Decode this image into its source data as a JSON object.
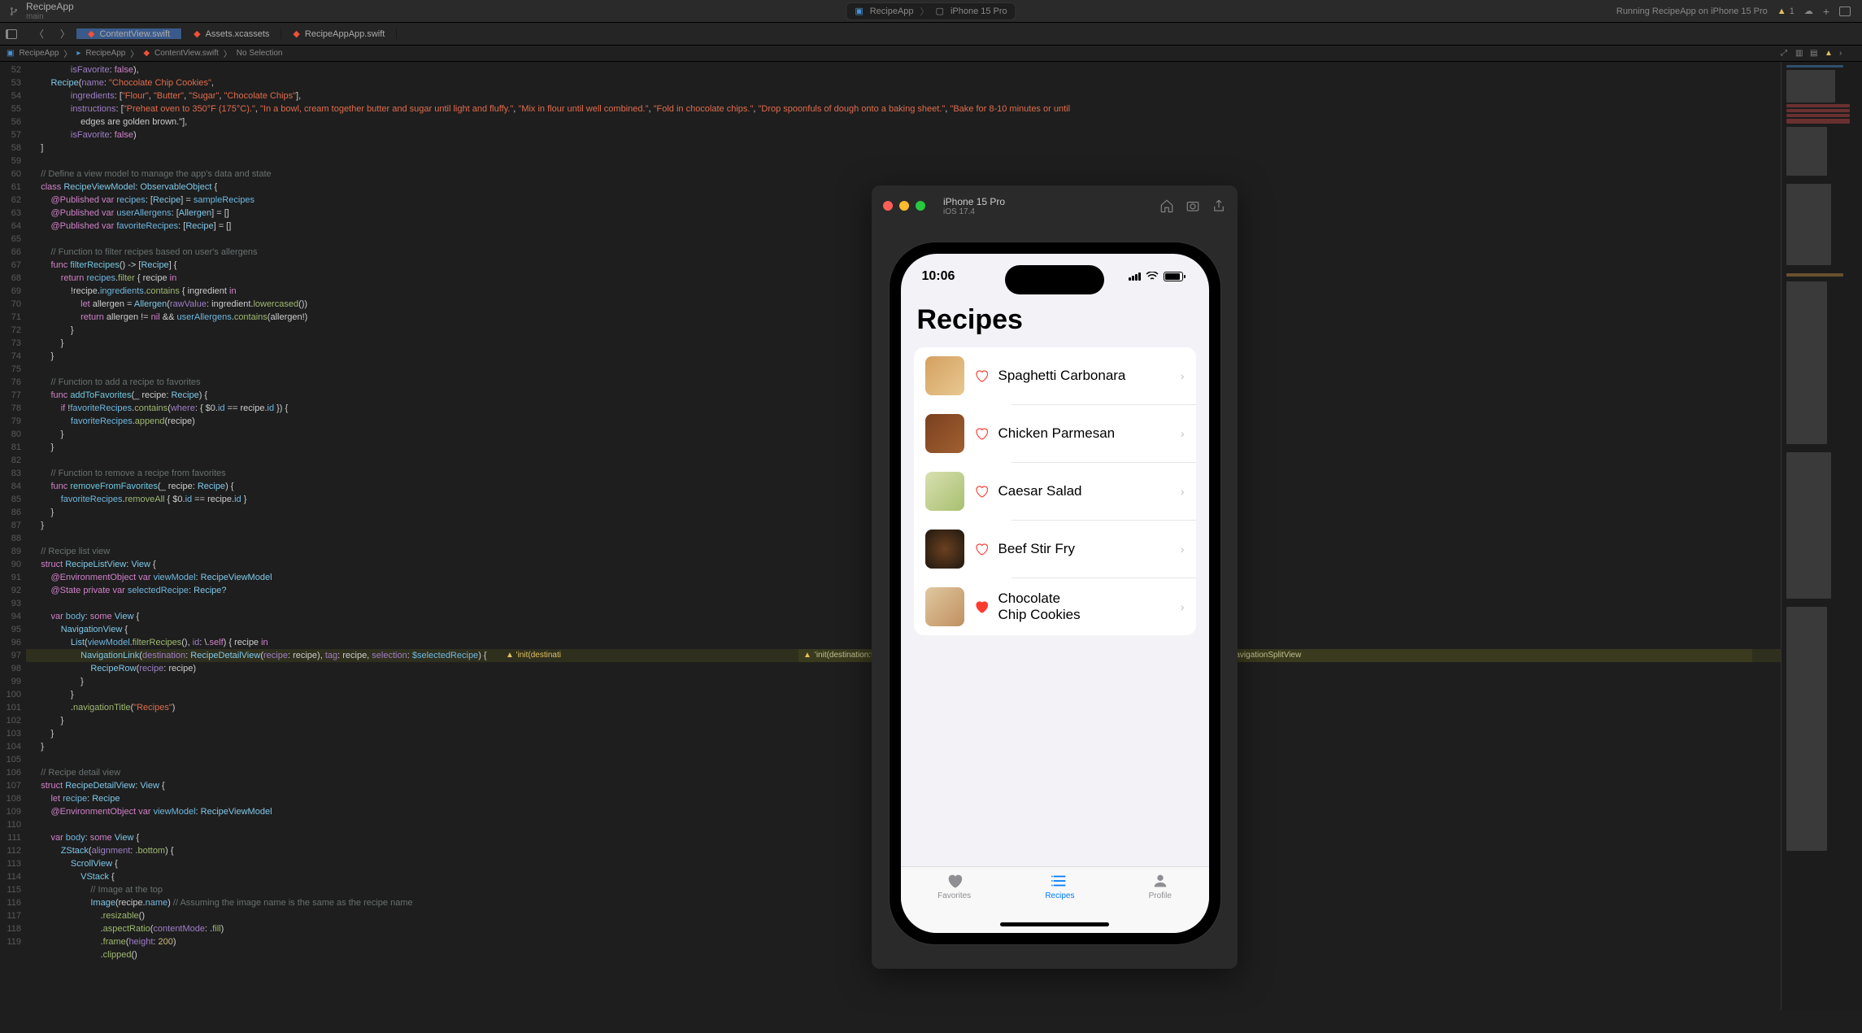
{
  "titlebar": {
    "project": "RecipeApp",
    "branch": "main",
    "scheme": "RecipeApp",
    "device": "iPhone 15 Pro",
    "status": "Running RecipeApp on iPhone 15 Pro",
    "warn_count": "1"
  },
  "tabs": [
    {
      "label": "ContentView.swift",
      "active": true
    },
    {
      "label": "Assets.xcassets",
      "active": false
    },
    {
      "label": "RecipeAppApp.swift",
      "active": false
    }
  ],
  "breadcrumb": {
    "items": [
      "RecipeApp",
      "RecipeApp",
      "ContentView.swift",
      "No Selection"
    ]
  },
  "warning_right": "'init(destination:tag:selection:label:)' or navigationDestination(isPresented:destination:), inside a NavigationStack or NavigationSplitView",
  "simulator": {
    "device": "iPhone 15 Pro",
    "os": "iOS 17.4",
    "time": "10:06",
    "title": "Recipes",
    "recipes": [
      {
        "name": "Spaghetti Carbonara",
        "fav": false
      },
      {
        "name": "Chicken Parmesan",
        "fav": false
      },
      {
        "name": "Caesar Salad",
        "fav": false
      },
      {
        "name": "Beef Stir Fry",
        "fav": false
      },
      {
        "name": "Chocolate\nChip Cookies",
        "fav": true
      }
    ],
    "tabs": [
      {
        "label": "Favorites",
        "sel": false
      },
      {
        "label": "Recipes",
        "sel": true
      },
      {
        "label": "Profile",
        "sel": false
      }
    ]
  },
  "code_lines": [
    {
      "n": 52,
      "html": "                <span class='c-param'>isFavorite</span>: <span class='c-bool'>false</span>),"
    },
    {
      "n": 53,
      "html": "        <span class='c-type'>Recipe</span>(<span class='c-param'>name</span>: <span class='c-str'>\"Chocolate Chip Cookies\"</span>,"
    },
    {
      "n": 54,
      "html": "                <span class='c-param'>ingredients</span>: [<span class='c-str'>\"Flour\"</span>, <span class='c-str'>\"Butter\"</span>, <span class='c-str'>\"Sugar\"</span>, <span class='c-str'>\"Chocolate Chips\"</span>],"
    },
    {
      "n": 55,
      "html": "                <span class='c-param'>instructions</span>: [<span class='c-str'>\"Preheat oven to 350°F (175°C).\"</span>, <span class='c-str'>\"In a bowl, cream together butter and sugar until light and fluffy.\"</span>, <span class='c-str'>\"Mix in flour until well combined.\"</span>, <span class='c-str'>\"Fold in chocolate chips.\"</span>, <span class='c-str'>\"Drop spoonfuls of dough onto a baking sheet.\"</span>, <span class='c-str'>\"Bake for 8-10 minutes or until\n                    edges are golden brown.\"</span>],"
    },
    {
      "n": 56,
      "html": "                <span class='c-param'>isFavorite</span>: <span class='c-bool'>false</span>)"
    },
    {
      "n": 57,
      "html": "    ]"
    },
    {
      "n": 58,
      "html": ""
    },
    {
      "n": 59,
      "html": "    <span class='c-cmt'>// Define a view model to manage the app's data and state</span>"
    },
    {
      "n": 60,
      "html": "    <span class='c-kw'>class</span> <span class='c-type'>RecipeViewModel</span>: <span class='c-type'>ObservableObject</span> {"
    },
    {
      "n": 61,
      "html": "        <span class='c-kw'>@Published</span> <span class='c-kw'>var</span> <span class='c-prop'>recipes</span>: [<span class='c-type'>Recipe</span>] = <span class='c-prop'>sampleRecipes</span>"
    },
    {
      "n": 62,
      "html": "        <span class='c-kw'>@Published</span> <span class='c-kw'>var</span> <span class='c-prop'>userAllergens</span>: [<span class='c-type'>Allergen</span>] = []"
    },
    {
      "n": 63,
      "html": "        <span class='c-kw'>@Published</span> <span class='c-kw'>var</span> <span class='c-prop'>favoriteRecipes</span>: [<span class='c-type'>Recipe</span>] = []"
    },
    {
      "n": 64,
      "html": ""
    },
    {
      "n": 65,
      "html": "        <span class='c-cmt'>// Function to filter recipes based on user's allergens</span>"
    },
    {
      "n": 66,
      "html": "        <span class='c-kw'>func</span> <span class='c-fn'>filterRecipes</span>() -> [<span class='c-type'>Recipe</span>] {"
    },
    {
      "n": 67,
      "html": "            <span class='c-kw'>return</span> <span class='c-prop'>recipes</span>.<span class='c-call'>filter</span> { recipe <span class='c-kw'>in</span>"
    },
    {
      "n": 68,
      "html": "                !recipe.<span class='c-prop'>ingredients</span>.<span class='c-call'>contains</span> { ingredient <span class='c-kw'>in</span>"
    },
    {
      "n": 69,
      "html": "                    <span class='c-kw'>let</span> allergen = <span class='c-type'>Allergen</span>(<span class='c-param'>rawValue</span>: ingredient.<span class='c-call'>lowercased</span>())"
    },
    {
      "n": 70,
      "html": "                    <span class='c-kw'>return</span> allergen != <span class='c-kw'>nil</span> && <span class='c-prop'>userAllergens</span>.<span class='c-call'>contains</span>(allergen!)"
    },
    {
      "n": 71,
      "html": "                }"
    },
    {
      "n": 72,
      "html": "            }"
    },
    {
      "n": 73,
      "html": "        }"
    },
    {
      "n": 74,
      "html": ""
    },
    {
      "n": 75,
      "html": "        <span class='c-cmt'>// Function to add a recipe to favorites</span>"
    },
    {
      "n": 76,
      "html": "        <span class='c-kw'>func</span> <span class='c-fn'>addToFavorites</span>(_ recipe: <span class='c-type'>Recipe</span>) {"
    },
    {
      "n": 77,
      "html": "            <span class='c-kw'>if</span> !<span class='c-prop'>favoriteRecipes</span>.<span class='c-call'>contains</span>(<span class='c-param'>where</span>: { $0.<span class='c-prop'>id</span> == recipe.<span class='c-prop'>id</span> }) {"
    },
    {
      "n": 78,
      "html": "                <span class='c-prop'>favoriteRecipes</span>.<span class='c-call'>append</span>(recipe)"
    },
    {
      "n": 79,
      "html": "            }"
    },
    {
      "n": 80,
      "html": "        }"
    },
    {
      "n": 81,
      "html": ""
    },
    {
      "n": 82,
      "html": "        <span class='c-cmt'>// Function to remove a recipe from favorites</span>"
    },
    {
      "n": 83,
      "html": "        <span class='c-kw'>func</span> <span class='c-fn'>removeFromFavorites</span>(_ recipe: <span class='c-type'>Recipe</span>) {"
    },
    {
      "n": 84,
      "html": "            <span class='c-prop'>favoriteRecipes</span>.<span class='c-call'>removeAll</span> { $0.<span class='c-prop'>id</span> == recipe.<span class='c-prop'>id</span> }"
    },
    {
      "n": 85,
      "html": "        }"
    },
    {
      "n": 86,
      "html": "    }"
    },
    {
      "n": 87,
      "html": ""
    },
    {
      "n": 88,
      "html": "    <span class='c-cmt'>// Recipe list view</span>"
    },
    {
      "n": 89,
      "html": "    <span class='c-kw'>struct</span> <span class='c-type'>RecipeListView</span>: <span class='c-type'>View</span> {"
    },
    {
      "n": 90,
      "html": "        <span class='c-kw'>@EnvironmentObject</span> <span class='c-kw'>var</span> <span class='c-prop'>viewModel</span>: <span class='c-type'>RecipeViewModel</span>"
    },
    {
      "n": 91,
      "html": "        <span class='c-kw'>@State</span> <span class='c-kw'>private</span> <span class='c-kw'>var</span> <span class='c-prop'>selectedRecipe</span>: <span class='c-type'>Recipe?</span>"
    },
    {
      "n": 92,
      "html": ""
    },
    {
      "n": 93,
      "html": "        <span class='c-kw'>var</span> <span class='c-prop'>body</span>: <span class='c-kw'>some</span> <span class='c-type'>View</span> {"
    },
    {
      "n": 94,
      "html": "            <span class='c-type'>NavigationView</span> {"
    },
    {
      "n": 95,
      "html": "                <span class='c-type'>List</span>(<span class='c-prop'>viewModel</span>.<span class='c-call'>filterRecipes</span>(), <span class='c-param'>id</span>: \\.<span class='c-kw'>self</span>) { recipe <span class='c-kw'>in</span>"
    },
    {
      "n": 96,
      "html": "                    <span class='c-type'>NavigationLink</span>(<span class='c-param'>destination</span>: <span class='c-type'>RecipeDetailView</span>(<span class='c-param'>recipe</span>: recipe), <span class='c-param'>tag</span>: recipe, <span class='c-param'>selection</span>: <span class='c-prop'>$selectedRecipe</span>) {",
      "warn": true
    },
    {
      "n": 97,
      "html": "                        <span class='c-type'>RecipeRow</span>(<span class='c-param'>recipe</span>: recipe)"
    },
    {
      "n": 98,
      "html": "                    }"
    },
    {
      "n": 99,
      "html": "                }"
    },
    {
      "n": 100,
      "html": "                .<span class='c-call'>navigationTitle</span>(<span class='c-str'>\"Recipes\"</span>)"
    },
    {
      "n": 101,
      "html": "            }"
    },
    {
      "n": 102,
      "html": "        }"
    },
    {
      "n": 103,
      "html": "    }"
    },
    {
      "n": 104,
      "html": ""
    },
    {
      "n": 105,
      "html": "    <span class='c-cmt'>// Recipe detail view</span>"
    },
    {
      "n": 106,
      "html": "    <span class='c-kw'>struct</span> <span class='c-type'>RecipeDetailView</span>: <span class='c-type'>View</span> {"
    },
    {
      "n": 107,
      "html": "        <span class='c-kw'>let</span> <span class='c-prop'>recipe</span>: <span class='c-type'>Recipe</span>"
    },
    {
      "n": 108,
      "html": "        <span class='c-kw'>@EnvironmentObject</span> <span class='c-kw'>var</span> <span class='c-prop'>viewModel</span>: <span class='c-type'>RecipeViewModel</span>"
    },
    {
      "n": 109,
      "html": ""
    },
    {
      "n": 110,
      "html": "        <span class='c-kw'>var</span> <span class='c-prop'>body</span>: <span class='c-kw'>some</span> <span class='c-type'>View</span> {"
    },
    {
      "n": 111,
      "html": "            <span class='c-type'>ZStack</span>(<span class='c-param'>alignment</span>: .<span class='c-call'>bottom</span>) {"
    },
    {
      "n": 112,
      "html": "                <span class='c-type'>ScrollView</span> {"
    },
    {
      "n": 113,
      "html": "                    <span class='c-type'>VStack</span> {"
    },
    {
      "n": 114,
      "html": "                        <span class='c-cmt'>// Image at the top</span>"
    },
    {
      "n": 115,
      "html": "                        <span class='c-type'>Image</span>(recipe.<span class='c-prop'>name</span>) <span class='c-cmt'>// Assuming the image name is the same as the recipe name</span>"
    },
    {
      "n": 116,
      "html": "                            .<span class='c-call'>resizable</span>()"
    },
    {
      "n": 117,
      "html": "                            .<span class='c-call'>aspectRatio</span>(<span class='c-param'>contentMode</span>: .<span class='c-call'>fill</span>)"
    },
    {
      "n": 118,
      "html": "                            .<span class='c-call'>frame</span>(<span class='c-param'>height</span>: <span class='c-num'>200</span>)"
    },
    {
      "n": 119,
      "html": "                            .<span class='c-call'>clipped</span>()"
    }
  ]
}
